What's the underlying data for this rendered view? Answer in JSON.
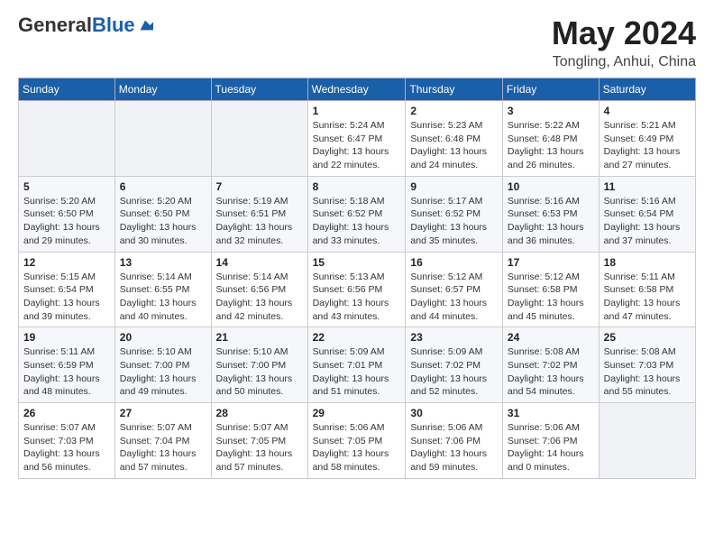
{
  "header": {
    "logo_general": "General",
    "logo_blue": "Blue",
    "title": "May 2024",
    "subtitle": "Tongling, Anhui, China"
  },
  "weekdays": [
    "Sunday",
    "Monday",
    "Tuesday",
    "Wednesday",
    "Thursday",
    "Friday",
    "Saturday"
  ],
  "weeks": [
    [
      {
        "day": "",
        "info": ""
      },
      {
        "day": "",
        "info": ""
      },
      {
        "day": "",
        "info": ""
      },
      {
        "day": "1",
        "info": "Sunrise: 5:24 AM\nSunset: 6:47 PM\nDaylight: 13 hours\nand 22 minutes."
      },
      {
        "day": "2",
        "info": "Sunrise: 5:23 AM\nSunset: 6:48 PM\nDaylight: 13 hours\nand 24 minutes."
      },
      {
        "day": "3",
        "info": "Sunrise: 5:22 AM\nSunset: 6:48 PM\nDaylight: 13 hours\nand 26 minutes."
      },
      {
        "day": "4",
        "info": "Sunrise: 5:21 AM\nSunset: 6:49 PM\nDaylight: 13 hours\nand 27 minutes."
      }
    ],
    [
      {
        "day": "5",
        "info": "Sunrise: 5:20 AM\nSunset: 6:50 PM\nDaylight: 13 hours\nand 29 minutes."
      },
      {
        "day": "6",
        "info": "Sunrise: 5:20 AM\nSunset: 6:50 PM\nDaylight: 13 hours\nand 30 minutes."
      },
      {
        "day": "7",
        "info": "Sunrise: 5:19 AM\nSunset: 6:51 PM\nDaylight: 13 hours\nand 32 minutes."
      },
      {
        "day": "8",
        "info": "Sunrise: 5:18 AM\nSunset: 6:52 PM\nDaylight: 13 hours\nand 33 minutes."
      },
      {
        "day": "9",
        "info": "Sunrise: 5:17 AM\nSunset: 6:52 PM\nDaylight: 13 hours\nand 35 minutes."
      },
      {
        "day": "10",
        "info": "Sunrise: 5:16 AM\nSunset: 6:53 PM\nDaylight: 13 hours\nand 36 minutes."
      },
      {
        "day": "11",
        "info": "Sunrise: 5:16 AM\nSunset: 6:54 PM\nDaylight: 13 hours\nand 37 minutes."
      }
    ],
    [
      {
        "day": "12",
        "info": "Sunrise: 5:15 AM\nSunset: 6:54 PM\nDaylight: 13 hours\nand 39 minutes."
      },
      {
        "day": "13",
        "info": "Sunrise: 5:14 AM\nSunset: 6:55 PM\nDaylight: 13 hours\nand 40 minutes."
      },
      {
        "day": "14",
        "info": "Sunrise: 5:14 AM\nSunset: 6:56 PM\nDaylight: 13 hours\nand 42 minutes."
      },
      {
        "day": "15",
        "info": "Sunrise: 5:13 AM\nSunset: 6:56 PM\nDaylight: 13 hours\nand 43 minutes."
      },
      {
        "day": "16",
        "info": "Sunrise: 5:12 AM\nSunset: 6:57 PM\nDaylight: 13 hours\nand 44 minutes."
      },
      {
        "day": "17",
        "info": "Sunrise: 5:12 AM\nSunset: 6:58 PM\nDaylight: 13 hours\nand 45 minutes."
      },
      {
        "day": "18",
        "info": "Sunrise: 5:11 AM\nSunset: 6:58 PM\nDaylight: 13 hours\nand 47 minutes."
      }
    ],
    [
      {
        "day": "19",
        "info": "Sunrise: 5:11 AM\nSunset: 6:59 PM\nDaylight: 13 hours\nand 48 minutes."
      },
      {
        "day": "20",
        "info": "Sunrise: 5:10 AM\nSunset: 7:00 PM\nDaylight: 13 hours\nand 49 minutes."
      },
      {
        "day": "21",
        "info": "Sunrise: 5:10 AM\nSunset: 7:00 PM\nDaylight: 13 hours\nand 50 minutes."
      },
      {
        "day": "22",
        "info": "Sunrise: 5:09 AM\nSunset: 7:01 PM\nDaylight: 13 hours\nand 51 minutes."
      },
      {
        "day": "23",
        "info": "Sunrise: 5:09 AM\nSunset: 7:02 PM\nDaylight: 13 hours\nand 52 minutes."
      },
      {
        "day": "24",
        "info": "Sunrise: 5:08 AM\nSunset: 7:02 PM\nDaylight: 13 hours\nand 54 minutes."
      },
      {
        "day": "25",
        "info": "Sunrise: 5:08 AM\nSunset: 7:03 PM\nDaylight: 13 hours\nand 55 minutes."
      }
    ],
    [
      {
        "day": "26",
        "info": "Sunrise: 5:07 AM\nSunset: 7:03 PM\nDaylight: 13 hours\nand 56 minutes."
      },
      {
        "day": "27",
        "info": "Sunrise: 5:07 AM\nSunset: 7:04 PM\nDaylight: 13 hours\nand 57 minutes."
      },
      {
        "day": "28",
        "info": "Sunrise: 5:07 AM\nSunset: 7:05 PM\nDaylight: 13 hours\nand 57 minutes."
      },
      {
        "day": "29",
        "info": "Sunrise: 5:06 AM\nSunset: 7:05 PM\nDaylight: 13 hours\nand 58 minutes."
      },
      {
        "day": "30",
        "info": "Sunrise: 5:06 AM\nSunset: 7:06 PM\nDaylight: 13 hours\nand 59 minutes."
      },
      {
        "day": "31",
        "info": "Sunrise: 5:06 AM\nSunset: 7:06 PM\nDaylight: 14 hours\nand 0 minutes."
      },
      {
        "day": "",
        "info": ""
      }
    ]
  ]
}
